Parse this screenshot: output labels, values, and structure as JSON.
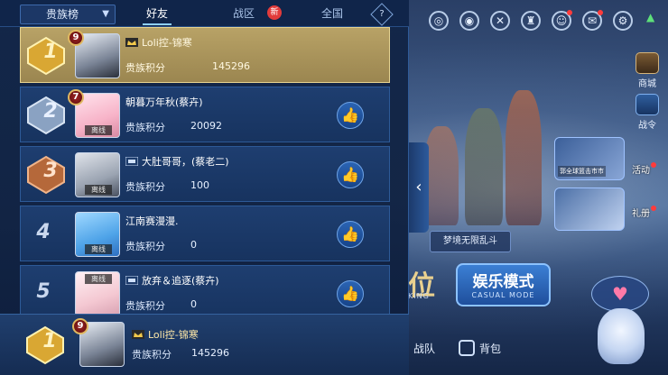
{
  "panel": {
    "region_selector": "贵族榜",
    "tabs": [
      {
        "label": "好友",
        "active": true
      },
      {
        "label": "战区",
        "active": false,
        "badge": "新"
      },
      {
        "label": "全国",
        "active": false
      }
    ],
    "help_icon": "?"
  },
  "rows": [
    {
      "rank": "1",
      "level": "9",
      "name": "Loli控-锦寒",
      "score_label": "贵族积分",
      "score": "145296",
      "highlight": true,
      "avatar_tag": ""
    },
    {
      "rank": "2",
      "level": "7",
      "name": "朝暮万年秋(蔡卉)",
      "score_label": "贵族积分",
      "score": "20092",
      "highlight": false,
      "avatar_tag": "离线"
    },
    {
      "rank": "3",
      "level": "",
      "name": "大肚哥哥，(蔡老二)",
      "score_label": "贵族积分",
      "score": "100",
      "highlight": false,
      "avatar_tag": "离线"
    },
    {
      "rank": "4",
      "level": "",
      "name": "江南赛漫漫.",
      "score_label": "贵族积分",
      "score": "0",
      "highlight": false,
      "avatar_tag": "离线"
    },
    {
      "rank": "5",
      "level": "",
      "name": "放弃＆追逐(蔡卉)",
      "score_label": "贵族积分",
      "score": "0",
      "highlight": false,
      "avatar_tag": "离线"
    }
  ],
  "my_rank": {
    "rank": "1",
    "level": "9",
    "name": "Loli控-锦寒",
    "score_label": "贵族积分",
    "score": "145296"
  },
  "scene": {
    "plaque": "梦境无限乱斗",
    "rank_word": "位",
    "rank_sub": "KING",
    "mode_title": "娱乐模式",
    "mode_sub": "CASUAL MODE",
    "shop": "商城",
    "battle_pass": "战令",
    "event": "活动",
    "event_promo": "郭全球篮击市市",
    "gift": "礼册",
    "team": "战队",
    "bag": "背包"
  },
  "colors": {
    "accent": "#8fd0ff",
    "highlight_row": "#b8a266",
    "badge_red": "#e23b3b"
  }
}
